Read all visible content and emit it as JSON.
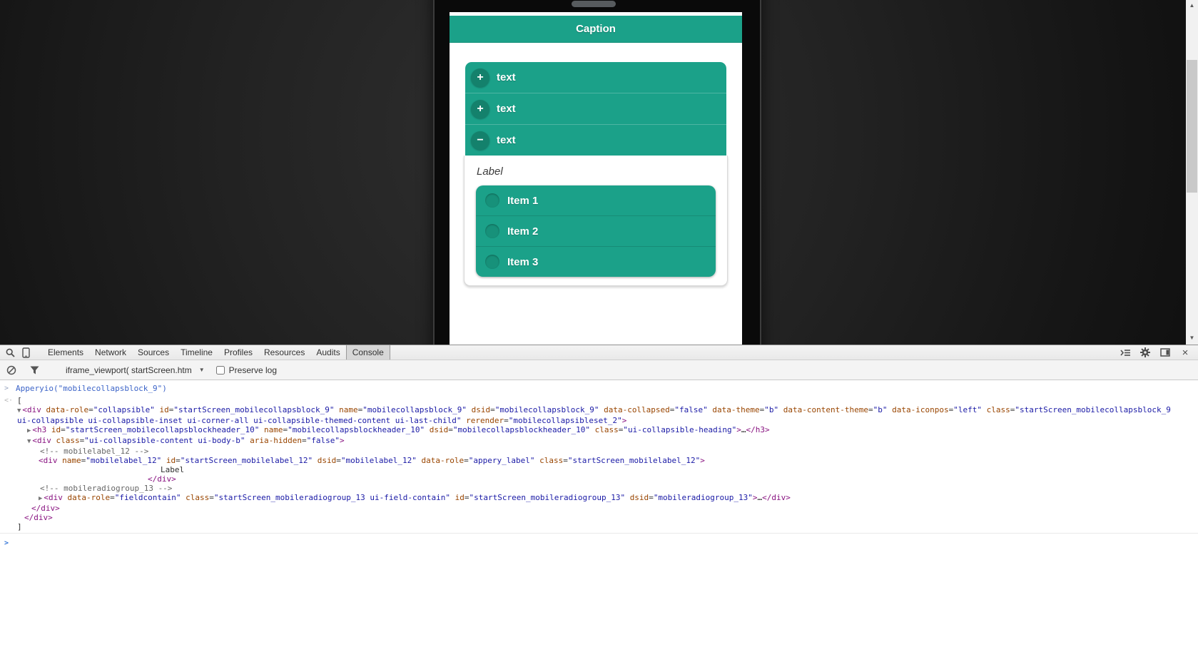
{
  "device": {
    "header": {
      "caption": "Caption"
    },
    "collapsible_items": [
      {
        "icon": "plus-icon",
        "glyph": "+",
        "label": "text"
      },
      {
        "icon": "plus-icon",
        "glyph": "+",
        "label": "text"
      },
      {
        "icon": "minus-icon",
        "glyph": "−",
        "label": "text"
      }
    ],
    "label_text": "Label",
    "radio_items": [
      {
        "label": "Item 1"
      },
      {
        "label": "Item 2"
      },
      {
        "label": "Item 3"
      }
    ]
  },
  "devtools": {
    "tabs": [
      "Elements",
      "Network",
      "Sources",
      "Timeline",
      "Profiles",
      "Resources",
      "Audits",
      "Console"
    ],
    "active_tab": "Console",
    "left_icons": [
      "search-icon",
      "device-icon"
    ],
    "right_icons": [
      "console-drawer-icon",
      "gear-icon",
      "dock-side-icon",
      "close-icon"
    ],
    "filterbar": {
      "icons": [
        "clear-console-icon",
        "filter-funnel-icon"
      ],
      "frame_selector": "iframe_viewport( startScreen.htm",
      "preserve_log_label": "Preserve log",
      "preserve_log_checked": false
    }
  },
  "scrollbar": {
    "up_glyph": "▲",
    "down_glyph": "▼"
  },
  "colors": {
    "teal_primary": "#1BA189",
    "teal_dark_circle": "#14816C",
    "teal_radio": "#17917A",
    "devtools_tag": "#881280",
    "devtools_attr": "#994500",
    "devtools_value": "#1A1AA6",
    "console_command_blue": "#3C64C8",
    "prompt_blue": "#3677D8",
    "background_dark": "#222222"
  },
  "console": {
    "lines": [
      {
        "kind": "input",
        "gutter": ">",
        "indent": 22,
        "parts": [
          [
            "cmd",
            "Apperyio(\"mobilecollapsblock_9\")"
          ]
        ]
      },
      {
        "kind": "result",
        "gutter": "<·",
        "indent": 24,
        "parts": [
          [
            "txt",
            "["
          ]
        ]
      },
      {
        "indent": 24,
        "parts": [
          [
            "tri",
            "▼"
          ],
          [
            "tag",
            "<div "
          ],
          [
            "attr",
            "data-role"
          ],
          [
            "eq",
            "="
          ],
          [
            "val",
            "\"collapsible\""
          ],
          [
            "sp",
            " "
          ],
          [
            "attr",
            "id"
          ],
          [
            "eq",
            "="
          ],
          [
            "val",
            "\"startScreen_mobilecollapsblock_9\""
          ],
          [
            "sp",
            " "
          ],
          [
            "attr",
            "name"
          ],
          [
            "eq",
            "="
          ],
          [
            "val",
            "\"mobilecollapsblock_9\""
          ],
          [
            "sp",
            " "
          ],
          [
            "attr",
            "dsid"
          ],
          [
            "eq",
            "="
          ],
          [
            "val",
            "\"mobilecollapsblock_9\""
          ],
          [
            "sp",
            " "
          ],
          [
            "attr",
            "data-collapsed"
          ],
          [
            "eq",
            "="
          ],
          [
            "val",
            "\"false\""
          ],
          [
            "sp",
            " "
          ],
          [
            "attr",
            "data-theme"
          ],
          [
            "eq",
            "="
          ],
          [
            "val",
            "\"b\""
          ],
          [
            "sp",
            " "
          ],
          [
            "attr",
            "data-content-theme"
          ],
          [
            "eq",
            "="
          ],
          [
            "val",
            "\"b\""
          ],
          [
            "sp",
            " "
          ],
          [
            "attr",
            "data-iconpos"
          ],
          [
            "eq",
            "="
          ],
          [
            "val",
            "\"left\""
          ],
          [
            "sp",
            " "
          ],
          [
            "attr",
            "class"
          ],
          [
            "eq",
            "="
          ],
          [
            "val",
            "\"startScreen_mobilecollapsblock_9"
          ]
        ]
      },
      {
        "indent": 24,
        "parts": [
          [
            "val",
            "ui-collapsible ui-collapsible-inset ui-corner-all ui-collapsible-themed-content ui-last-child\""
          ],
          [
            "sp",
            " "
          ],
          [
            "attr",
            "rerender"
          ],
          [
            "eq",
            "="
          ],
          [
            "val",
            "\"mobilecollapsibleset_2\""
          ],
          [
            "tag",
            ">"
          ]
        ]
      },
      {
        "indent": 38,
        "parts": [
          [
            "tri",
            "▶"
          ],
          [
            "tag",
            "<h3 "
          ],
          [
            "attr",
            "id"
          ],
          [
            "eq",
            "="
          ],
          [
            "val",
            "\"startScreen_mobilecollapsblockheader_10\""
          ],
          [
            "sp",
            " "
          ],
          [
            "attr",
            "name"
          ],
          [
            "eq",
            "="
          ],
          [
            "val",
            "\"mobilecollapsblockheader_10\""
          ],
          [
            "sp",
            " "
          ],
          [
            "attr",
            "dsid"
          ],
          [
            "eq",
            "="
          ],
          [
            "val",
            "\"mobilecollapsblockheader_10\""
          ],
          [
            "sp",
            " "
          ],
          [
            "attr",
            "class"
          ],
          [
            "eq",
            "="
          ],
          [
            "val",
            "\"ui-collapsible-heading\""
          ],
          [
            "tag",
            ">"
          ],
          [
            "dots",
            "…"
          ],
          [
            "tag",
            "</h3>"
          ]
        ]
      },
      {
        "indent": 38,
        "parts": [
          [
            "tri",
            "▼"
          ],
          [
            "tag",
            "<div "
          ],
          [
            "attr",
            "class"
          ],
          [
            "eq",
            "="
          ],
          [
            "val",
            "\"ui-collapsible-content ui-body-b\""
          ],
          [
            "sp",
            " "
          ],
          [
            "attr",
            "aria-hidden"
          ],
          [
            "eq",
            "="
          ],
          [
            "val",
            "\"false\""
          ],
          [
            "tag",
            ">"
          ]
        ]
      },
      {
        "indent": 56,
        "parts": [
          [
            "com",
            "<!-- mobilelabel_12 -->"
          ]
        ]
      },
      {
        "indent": 54,
        "parts": [
          [
            "tag",
            "<div "
          ],
          [
            "attr",
            "name"
          ],
          [
            "eq",
            "="
          ],
          [
            "val",
            "\"mobilelabel_12\""
          ],
          [
            "sp",
            " "
          ],
          [
            "attr",
            "id"
          ],
          [
            "eq",
            "="
          ],
          [
            "val",
            "\"startScreen_mobilelabel_12\""
          ],
          [
            "sp",
            " "
          ],
          [
            "attr",
            "dsid"
          ],
          [
            "eq",
            "="
          ],
          [
            "val",
            "\"mobilelabel_12\""
          ],
          [
            "sp",
            " "
          ],
          [
            "attr",
            "data-role"
          ],
          [
            "eq",
            "="
          ],
          [
            "val",
            "\"appery_label\""
          ],
          [
            "sp",
            " "
          ],
          [
            "attr",
            "class"
          ],
          [
            "eq",
            "="
          ],
          [
            "val",
            "\"startScreen_mobilelabel_12\""
          ],
          [
            "tag",
            ">"
          ]
        ]
      },
      {
        "indent": 225,
        "parts": [
          [
            "txt",
            "Label"
          ]
        ]
      },
      {
        "indent": 207,
        "parts": [
          [
            "tag",
            "</div>"
          ]
        ]
      },
      {
        "indent": 56,
        "parts": [
          [
            "com",
            "<!-- mobileradiogroup_13 -->"
          ]
        ]
      },
      {
        "indent": 54,
        "parts": [
          [
            "tri",
            "▶"
          ],
          [
            "tag",
            "<div "
          ],
          [
            "attr",
            "data-role"
          ],
          [
            "eq",
            "="
          ],
          [
            "val",
            "\"fieldcontain\""
          ],
          [
            "sp",
            " "
          ],
          [
            "attr",
            "class"
          ],
          [
            "eq",
            "="
          ],
          [
            "val",
            "\"startScreen_mobileradiogroup_13 ui-field-contain\""
          ],
          [
            "sp",
            " "
          ],
          [
            "attr",
            "id"
          ],
          [
            "eq",
            "="
          ],
          [
            "val",
            "\"startScreen_mobileradiogroup_13\""
          ],
          [
            "sp",
            " "
          ],
          [
            "attr",
            "dsid"
          ],
          [
            "eq",
            "="
          ],
          [
            "val",
            "\"mobileradiogroup_13\""
          ],
          [
            "tag",
            ">"
          ],
          [
            "dots",
            "…"
          ],
          [
            "tag",
            "</div>"
          ]
        ]
      },
      {
        "indent": 44,
        "parts": [
          [
            "tag",
            "</div>"
          ]
        ]
      },
      {
        "indent": 34,
        "parts": [
          [
            "tag",
            "</div>"
          ]
        ]
      },
      {
        "indent": 24,
        "hr": true,
        "parts": [
          [
            "txt",
            "]"
          ]
        ]
      },
      {
        "kind": "prompt",
        "gutter": ">",
        "indent": 22,
        "parts": []
      }
    ]
  }
}
